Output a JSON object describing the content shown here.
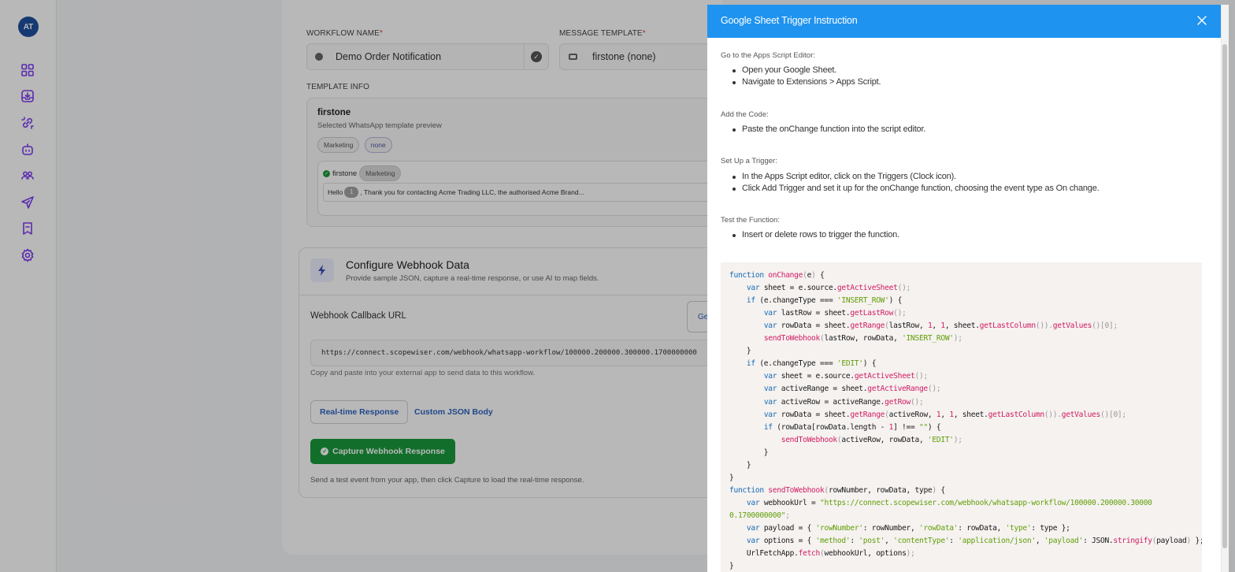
{
  "app": {
    "user_initials": "AT",
    "accent_color": "#7d3cf2",
    "header_color": "#1f93f0"
  },
  "sidebar": {
    "items": [
      {
        "icon": "dashboard-icon"
      },
      {
        "icon": "inbox-icon"
      },
      {
        "icon": "link-icon"
      },
      {
        "icon": "bot-icon"
      },
      {
        "icon": "contacts-icon"
      },
      {
        "icon": "send-icon"
      },
      {
        "icon": "bookmark-icon"
      },
      {
        "icon": "settings-icon"
      }
    ]
  },
  "form": {
    "workflow_name_label": "WORKFLOW NAME",
    "workflow_name_value": "Demo Order Notification",
    "message_template_label": "MESSAGE TEMPLATE",
    "message_template_value": "firstone (none)",
    "required_mark": "*",
    "template_info_label": "TEMPLATE INFO"
  },
  "template_info": {
    "name": "firstone",
    "subtitle": "Selected WhatsApp template preview",
    "chips": [
      "Marketing",
      "none"
    ],
    "preview_name": "firstone",
    "preview_chip": "Marketing",
    "message_prefix": "Hello",
    "var_number": "1",
    "message_rest": ", Thank you for contacting Acme Trading LLC, the authorised Acme Brand..."
  },
  "webhook": {
    "title": "Configure Webhook Data",
    "subtitle": "Provide sample JSON, capture a real-time response, or use AI to map fields.",
    "callback_label": "Webhook Callback URL",
    "side_button_label": "Ge",
    "url": "https://connect.scopewiser.com/webhook/whatsapp-workflow/100000.200000.300000.1700000000",
    "url_help": "Copy and paste into your external app to send data to this workflow.",
    "tab_realtime": "Real-time Response",
    "tab_custom": "Custom JSON Body",
    "capture_button": "Capture Webhook Response",
    "capture_help": "Send a test event from your app, then click Capture to load the real-time response."
  },
  "drawer": {
    "title": "Google Sheet Trigger Instruction",
    "sections": [
      {
        "title": "Go to the Apps Script Editor:",
        "items": [
          "Open your Google Sheet.",
          "Navigate to Extensions > Apps Script."
        ]
      },
      {
        "title": "Add the Code:",
        "items": [
          "Paste the onChange function into the script editor."
        ]
      },
      {
        "title": "Set Up a Trigger:",
        "items": [
          "In the Apps Script editor, click on the Triggers (Clock icon).",
          "Click Add Trigger and set it up for the onChange function, choosing the event type as On change."
        ]
      },
      {
        "title": "Test the Function:",
        "items": [
          "Insert or delete rows to trigger the function."
        ]
      }
    ],
    "code_lines": [
      [
        [
          "kw",
          "function"
        ],
        [
          "t",
          " "
        ],
        [
          "fn",
          "onChange"
        ],
        [
          "pn",
          "("
        ],
        [
          "t",
          "e"
        ],
        [
          "pn",
          ")"
        ],
        [
          "t",
          " {"
        ]
      ],
      [
        [
          "t",
          "    "
        ],
        [
          "kw",
          "var"
        ],
        [
          "t",
          " sheet = e.source."
        ],
        [
          "fn",
          "getActiveSheet"
        ],
        [
          "pn",
          "();"
        ]
      ],
      [
        [
          "t",
          "    "
        ],
        [
          "kw",
          "if"
        ],
        [
          "t",
          " ("
        ],
        [
          "t",
          "e.changeType === "
        ],
        [
          "str",
          "'INSERT_ROW'"
        ],
        [
          "t",
          ") {"
        ]
      ],
      [
        [
          "t",
          "        "
        ],
        [
          "kw",
          "var"
        ],
        [
          "t",
          " lastRow = sheet."
        ],
        [
          "fn",
          "getLastRow"
        ],
        [
          "pn",
          "();"
        ]
      ],
      [
        [
          "t",
          "        "
        ],
        [
          "kw",
          "var"
        ],
        [
          "t",
          " rowData = sheet."
        ],
        [
          "fn",
          "getRange"
        ],
        [
          "pn",
          "("
        ],
        [
          "t",
          "lastRow, "
        ],
        [
          "fn",
          "1"
        ],
        [
          "t",
          ", "
        ],
        [
          "fn",
          "1"
        ],
        [
          "t",
          ", sheet."
        ],
        [
          "fn",
          "getLastColumn"
        ],
        [
          "pn",
          "())."
        ],
        [
          "fn",
          "getValues"
        ],
        [
          "pn",
          "()[0];"
        ]
      ],
      [
        [
          "t",
          "        "
        ],
        [
          "fn",
          "sendToWebhook"
        ],
        [
          "pn",
          "("
        ],
        [
          "t",
          "lastRow, rowData, "
        ],
        [
          "str",
          "'INSERT_ROW'"
        ],
        [
          "pn",
          ");"
        ]
      ],
      [
        [
          "t",
          "    }"
        ]
      ],
      [
        [
          "t",
          "    "
        ],
        [
          "kw",
          "if"
        ],
        [
          "t",
          " (e.changeType === "
        ],
        [
          "str",
          "'EDIT'"
        ],
        [
          "t",
          ") {"
        ]
      ],
      [
        [
          "t",
          "        "
        ],
        [
          "kw",
          "var"
        ],
        [
          "t",
          " sheet = e.source."
        ],
        [
          "fn",
          "getActiveSheet"
        ],
        [
          "pn",
          "();"
        ]
      ],
      [
        [
          "t",
          "        "
        ],
        [
          "kw",
          "var"
        ],
        [
          "t",
          " activeRange = sheet."
        ],
        [
          "fn",
          "getActiveRange"
        ],
        [
          "pn",
          "();"
        ]
      ],
      [
        [
          "t",
          "        "
        ],
        [
          "kw",
          "var"
        ],
        [
          "t",
          " activeRow = activeRange."
        ],
        [
          "fn",
          "getRow"
        ],
        [
          "pn",
          "();"
        ]
      ],
      [
        [
          "t",
          "        "
        ],
        [
          "kw",
          "var"
        ],
        [
          "t",
          " rowData = sheet."
        ],
        [
          "fn",
          "getRange"
        ],
        [
          "pn",
          "("
        ],
        [
          "t",
          "activeRow, "
        ],
        [
          "fn",
          "1"
        ],
        [
          "t",
          ", "
        ],
        [
          "fn",
          "1"
        ],
        [
          "t",
          ", sheet."
        ],
        [
          "fn",
          "getLastColumn"
        ],
        [
          "pn",
          "())."
        ],
        [
          "fn",
          "getValues"
        ],
        [
          "pn",
          "()[0];"
        ]
      ],
      [
        [
          "t",
          "        "
        ],
        [
          "kw",
          "if"
        ],
        [
          "t",
          " (rowData[rowData.length - "
        ],
        [
          "fn",
          "1"
        ],
        [
          "t",
          "] !== "
        ],
        [
          "str",
          "\"\""
        ],
        [
          "t",
          ") {"
        ]
      ],
      [
        [
          "t",
          "            "
        ],
        [
          "fn",
          "sendToWebhook"
        ],
        [
          "pn",
          "("
        ],
        [
          "t",
          "activeRow, rowData, "
        ],
        [
          "str",
          "'EDIT'"
        ],
        [
          "pn",
          ");"
        ]
      ],
      [
        [
          "t",
          "        }"
        ]
      ],
      [
        [
          "t",
          "    }"
        ]
      ],
      [
        [
          "t",
          "}"
        ]
      ],
      [
        [
          "kw",
          "function"
        ],
        [
          "t",
          " "
        ],
        [
          "fn",
          "sendToWebhook"
        ],
        [
          "pn",
          "("
        ],
        [
          "t",
          "rowNumber, rowData, type"
        ],
        [
          "pn",
          ")"
        ],
        [
          "t",
          " {"
        ]
      ],
      [
        [
          "t",
          "    "
        ],
        [
          "kw",
          "var"
        ],
        [
          "t",
          " webhookUrl = "
        ],
        [
          "str",
          "\"https://connect.scopewiser.com/webhook/whatsapp-workflow/100000.200000.30000"
        ]
      ],
      [
        [
          "str",
          "0.1700000000\""
        ],
        [
          "pn",
          ";"
        ]
      ],
      [
        [
          "t",
          "    "
        ],
        [
          "kw",
          "var"
        ],
        [
          "t",
          " payload = { "
        ],
        [
          "str",
          "'rowNumber'"
        ],
        [
          "t",
          ": rowNumber, "
        ],
        [
          "str",
          "'rowData'"
        ],
        [
          "t",
          ": rowData, "
        ],
        [
          "str",
          "'type'"
        ],
        [
          "t",
          ": type };"
        ]
      ],
      [
        [
          "t",
          "    "
        ],
        [
          "kw",
          "var"
        ],
        [
          "t",
          " options = { "
        ],
        [
          "str",
          "'method'"
        ],
        [
          "t",
          ": "
        ],
        [
          "str",
          "'post'"
        ],
        [
          "t",
          ", "
        ],
        [
          "str",
          "'contentType'"
        ],
        [
          "t",
          ": "
        ],
        [
          "str",
          "'application/json'"
        ],
        [
          "t",
          ", "
        ],
        [
          "str",
          "'payload'"
        ],
        [
          "t",
          ": JSON."
        ],
        [
          "fn",
          "stringify"
        ],
        [
          "pn",
          "("
        ],
        [
          "t",
          "payload"
        ],
        [
          "pn",
          ")"
        ],
        [
          "t",
          " };"
        ]
      ],
      [
        [
          "t",
          "    UrlFetchApp."
        ],
        [
          "fn",
          "fetch"
        ],
        [
          "pn",
          "("
        ],
        [
          "t",
          "webhookUrl, options"
        ],
        [
          "pn",
          ");"
        ]
      ],
      [
        [
          "t",
          "}"
        ]
      ]
    ]
  }
}
